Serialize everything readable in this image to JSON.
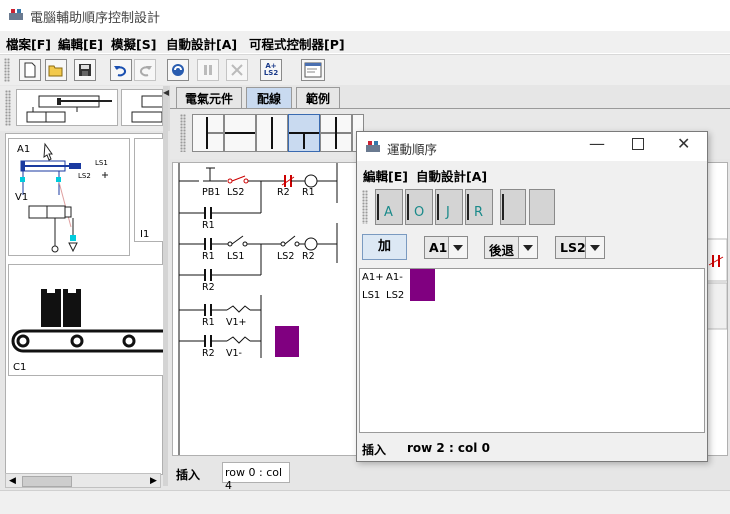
{
  "app": {
    "title": "電腦輔助順序控制設計"
  },
  "menu": {
    "file": "檔案[F]",
    "edit": "編輯[E]",
    "simulate": "模擬[S]",
    "auto_design": "自動設計[A]",
    "plc": "可程式控制器[P]"
  },
  "toolbar": {
    "ls2_button": "A+ LS2"
  },
  "left_panel": {
    "component_label_1": "A1",
    "component_label_2": "V1",
    "ls1_label": "LS1",
    "ls2_label": "LS2",
    "side_label": "I1",
    "conveyor_label": "C1"
  },
  "tabs": [
    "電氣元件",
    "配線",
    "範例"
  ],
  "ladder": {
    "rows": [
      [
        "PB1",
        "LS2",
        "R2",
        "R1"
      ],
      [
        "R1"
      ],
      [
        "R1",
        "LS1",
        "LS2",
        "R2"
      ],
      [
        "R2"
      ],
      [
        "R1",
        "V1+"
      ],
      [
        "R2",
        "V1-"
      ]
    ],
    "colors": {
      "nc_contact": "#cc0000",
      "solenoid_block": "#800080"
    }
  },
  "main_status": {
    "mode": "插入",
    "position": "row 0 : col 4"
  },
  "dialog": {
    "title": "運動順序",
    "menu": {
      "edit": "編輯[E]",
      "auto_design": "自動設計[A]"
    },
    "palette": [
      "A",
      "O",
      "J",
      "R"
    ],
    "add_button": "加",
    "actuator_select": "A1",
    "direction_select": "後退",
    "sensor_select": "LS2",
    "sequence_actions": [
      "A1+",
      "A1-"
    ],
    "sequence_sensors": [
      "LS1",
      "LS2"
    ],
    "cursor_color": "#800080",
    "status_mode": "插入",
    "status_position": "row 2 : col 0"
  }
}
